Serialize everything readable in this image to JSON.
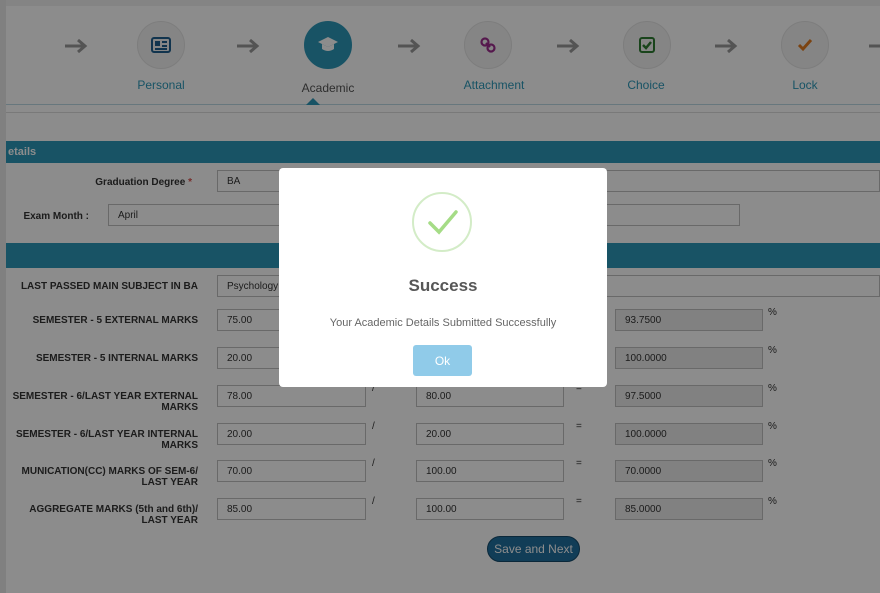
{
  "wizard": {
    "steps": [
      {
        "label": "Personal",
        "icon": "id-card-icon"
      },
      {
        "label": "Academic",
        "icon": "graduation-cap-icon"
      },
      {
        "label": "Attachment",
        "icon": "link-icon"
      },
      {
        "label": "Choice",
        "icon": "checkbox-icon"
      },
      {
        "label": "Lock",
        "icon": "check-icon"
      }
    ],
    "active_step": "Academic"
  },
  "section1": {
    "title": "etails",
    "degree_label": "Graduation Degree",
    "required_mark": "*",
    "degree_value": "BA",
    "exam_month_label": "Exam Month :",
    "exam_month_value": "April"
  },
  "marks": {
    "subject_label": "LAST PASSED MAIN SUBJECT IN BA",
    "subject_value": "Psychology",
    "rows": [
      {
        "label": "SEMESTER - 5 EXTERNAL MARKS",
        "obtained": "75.00",
        "total": "",
        "percent": "93.7500"
      },
      {
        "label": "SEMESTER - 5 INTERNAL MARKS",
        "obtained": "20.00",
        "total": "",
        "percent": "100.0000"
      },
      {
        "label": "SEMESTER - 6/LAST YEAR EXTERNAL MARKS",
        "obtained": "78.00",
        "total": "80.00",
        "percent": "97.5000"
      },
      {
        "label": "SEMESTER - 6/LAST YEAR INTERNAL MARKS",
        "obtained": "20.00",
        "total": "20.00",
        "percent": "100.0000"
      },
      {
        "label": "MUNICATION(CC) MARKS OF SEM-6/ LAST YEAR",
        "obtained": "70.00",
        "total": "100.00",
        "percent": "70.0000"
      },
      {
        "label": "AGGREGATE MARKS (5th and 6th)/ LAST YEAR",
        "obtained": "85.00",
        "total": "100.00",
        "percent": "85.0000"
      }
    ],
    "slash": "/",
    "equals": "=",
    "percent_sign": "%"
  },
  "save_button": "Save and Next",
  "modal": {
    "title": "Success",
    "message": "Your Academic Details Submitted Successfully",
    "ok_label": "Ok"
  },
  "colors": {
    "accent": "#2c98b8",
    "button": "#1f6f9e",
    "success": "#a5dc86"
  }
}
